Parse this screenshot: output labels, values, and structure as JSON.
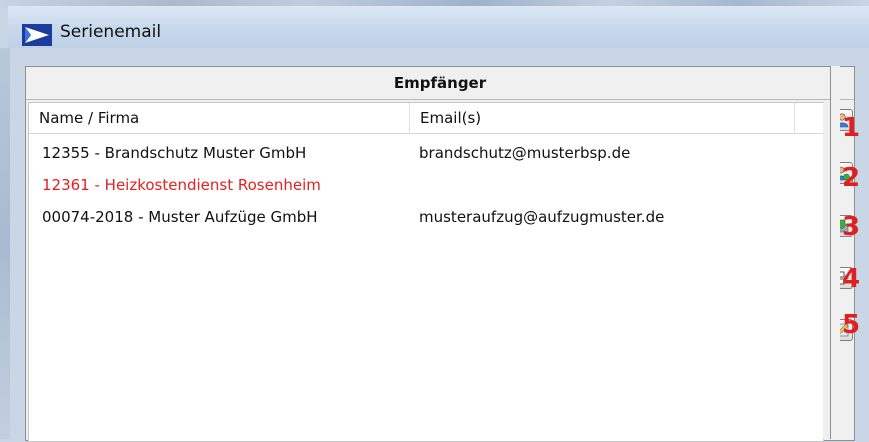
{
  "window": {
    "title": "Serienemail",
    "app_icon": "serienemail-app-icon"
  },
  "panel": {
    "header": "Empfänger",
    "columns": {
      "name": "Name / Firma",
      "email": "Email(s)"
    },
    "rows": [
      {
        "name": "12355 - Brandschutz Muster GmbH",
        "email": "brandschutz@musterbsp.de",
        "color": "#111111"
      },
      {
        "name": "12361 - Heizkostendienst Rosenheim",
        "email": "",
        "color": "#e52020"
      },
      {
        "name": "00074-2018 - Muster Aufzüge GmbH",
        "email": "musteraufzug@aufzugmuster.de",
        "color": "#111111"
      }
    ]
  },
  "toolbar": {
    "buttons": [
      {
        "icon": "person-icon",
        "number": "1"
      },
      {
        "icon": "person-add-icon",
        "number": "2"
      },
      {
        "icon": "import-icon",
        "number": "3"
      },
      {
        "icon": "structure-arrow-icon",
        "number": "4"
      },
      {
        "icon": "edit-pencil-icon",
        "number": "5"
      }
    ],
    "number_color": "#e02020"
  }
}
